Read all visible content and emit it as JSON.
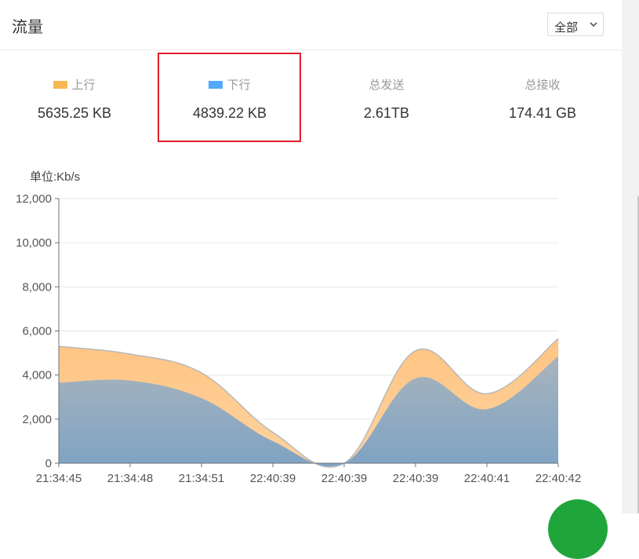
{
  "header": {
    "title": "流量",
    "filter_value": "全部"
  },
  "stats": [
    {
      "label": "上行",
      "value": "5635.25 KB",
      "swatch": "#f7b851"
    },
    {
      "label": "下行",
      "value": "4839.22 KB",
      "swatch": "#52a9ff"
    },
    {
      "label": "总发送",
      "value": "2.61TB"
    },
    {
      "label": "总接收",
      "value": "174.41 GB"
    }
  ],
  "chart_data": {
    "type": "area",
    "unit_label": "单位:Kb/s",
    "categories": [
      "21:34:45",
      "21:34:48",
      "21:34:51",
      "22:40:39",
      "22:40:39",
      "22:40:39",
      "22:40:41",
      "22:40:42"
    ],
    "ylim": [
      0,
      12000
    ],
    "yticks": [
      0,
      2000,
      4000,
      6000,
      8000,
      10000,
      12000
    ],
    "ytick_labels": [
      "0",
      "2,000",
      "4,000",
      "6,000",
      "8,000",
      "10,000",
      "12,000"
    ],
    "grid": true,
    "stacked": false,
    "series": [
      {
        "name": "上行",
        "color": "#ffc786",
        "values": [
          5300,
          4950,
          4100,
          1400,
          0,
          5100,
          3150,
          5650
        ]
      },
      {
        "name": "下行",
        "color": "#8aa6be",
        "values": [
          3650,
          3750,
          2950,
          1000,
          0,
          3850,
          2450,
          4850
        ]
      }
    ]
  },
  "colors": {
    "highlight_border": "#e0202a",
    "fab": "#20a53a"
  }
}
